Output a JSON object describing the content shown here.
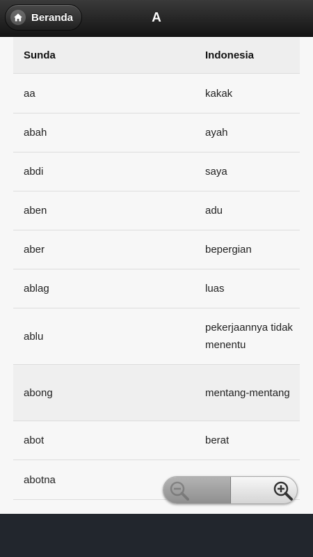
{
  "header": {
    "home_label": "Beranda",
    "title": "A"
  },
  "table": {
    "columns": [
      "Sunda",
      "Indonesia"
    ],
    "rows": [
      {
        "sunda": "aa",
        "indonesia": "kakak"
      },
      {
        "sunda": "abah",
        "indonesia": "ayah"
      },
      {
        "sunda": "abdi",
        "indonesia": "saya"
      },
      {
        "sunda": "aben",
        "indonesia": "adu"
      },
      {
        "sunda": "aber",
        "indonesia": "bepergian"
      },
      {
        "sunda": "ablag",
        "indonesia": "luas"
      },
      {
        "sunda": "ablu",
        "indonesia": "pekerjaannya tidak menentu"
      },
      {
        "sunda": "abong",
        "indonesia": "mentang-mentang"
      },
      {
        "sunda": "abot",
        "indonesia": "berat"
      },
      {
        "sunda": "abotna",
        "indonesia": ""
      }
    ]
  },
  "zoom_control": {
    "zoom_out_icon": "zoom-out-icon",
    "zoom_in_icon": "zoom-in-icon"
  },
  "colors": {
    "topbar": "#1f1f1f",
    "bottom_bar": "#22262d",
    "background": "#f7f7f7"
  }
}
